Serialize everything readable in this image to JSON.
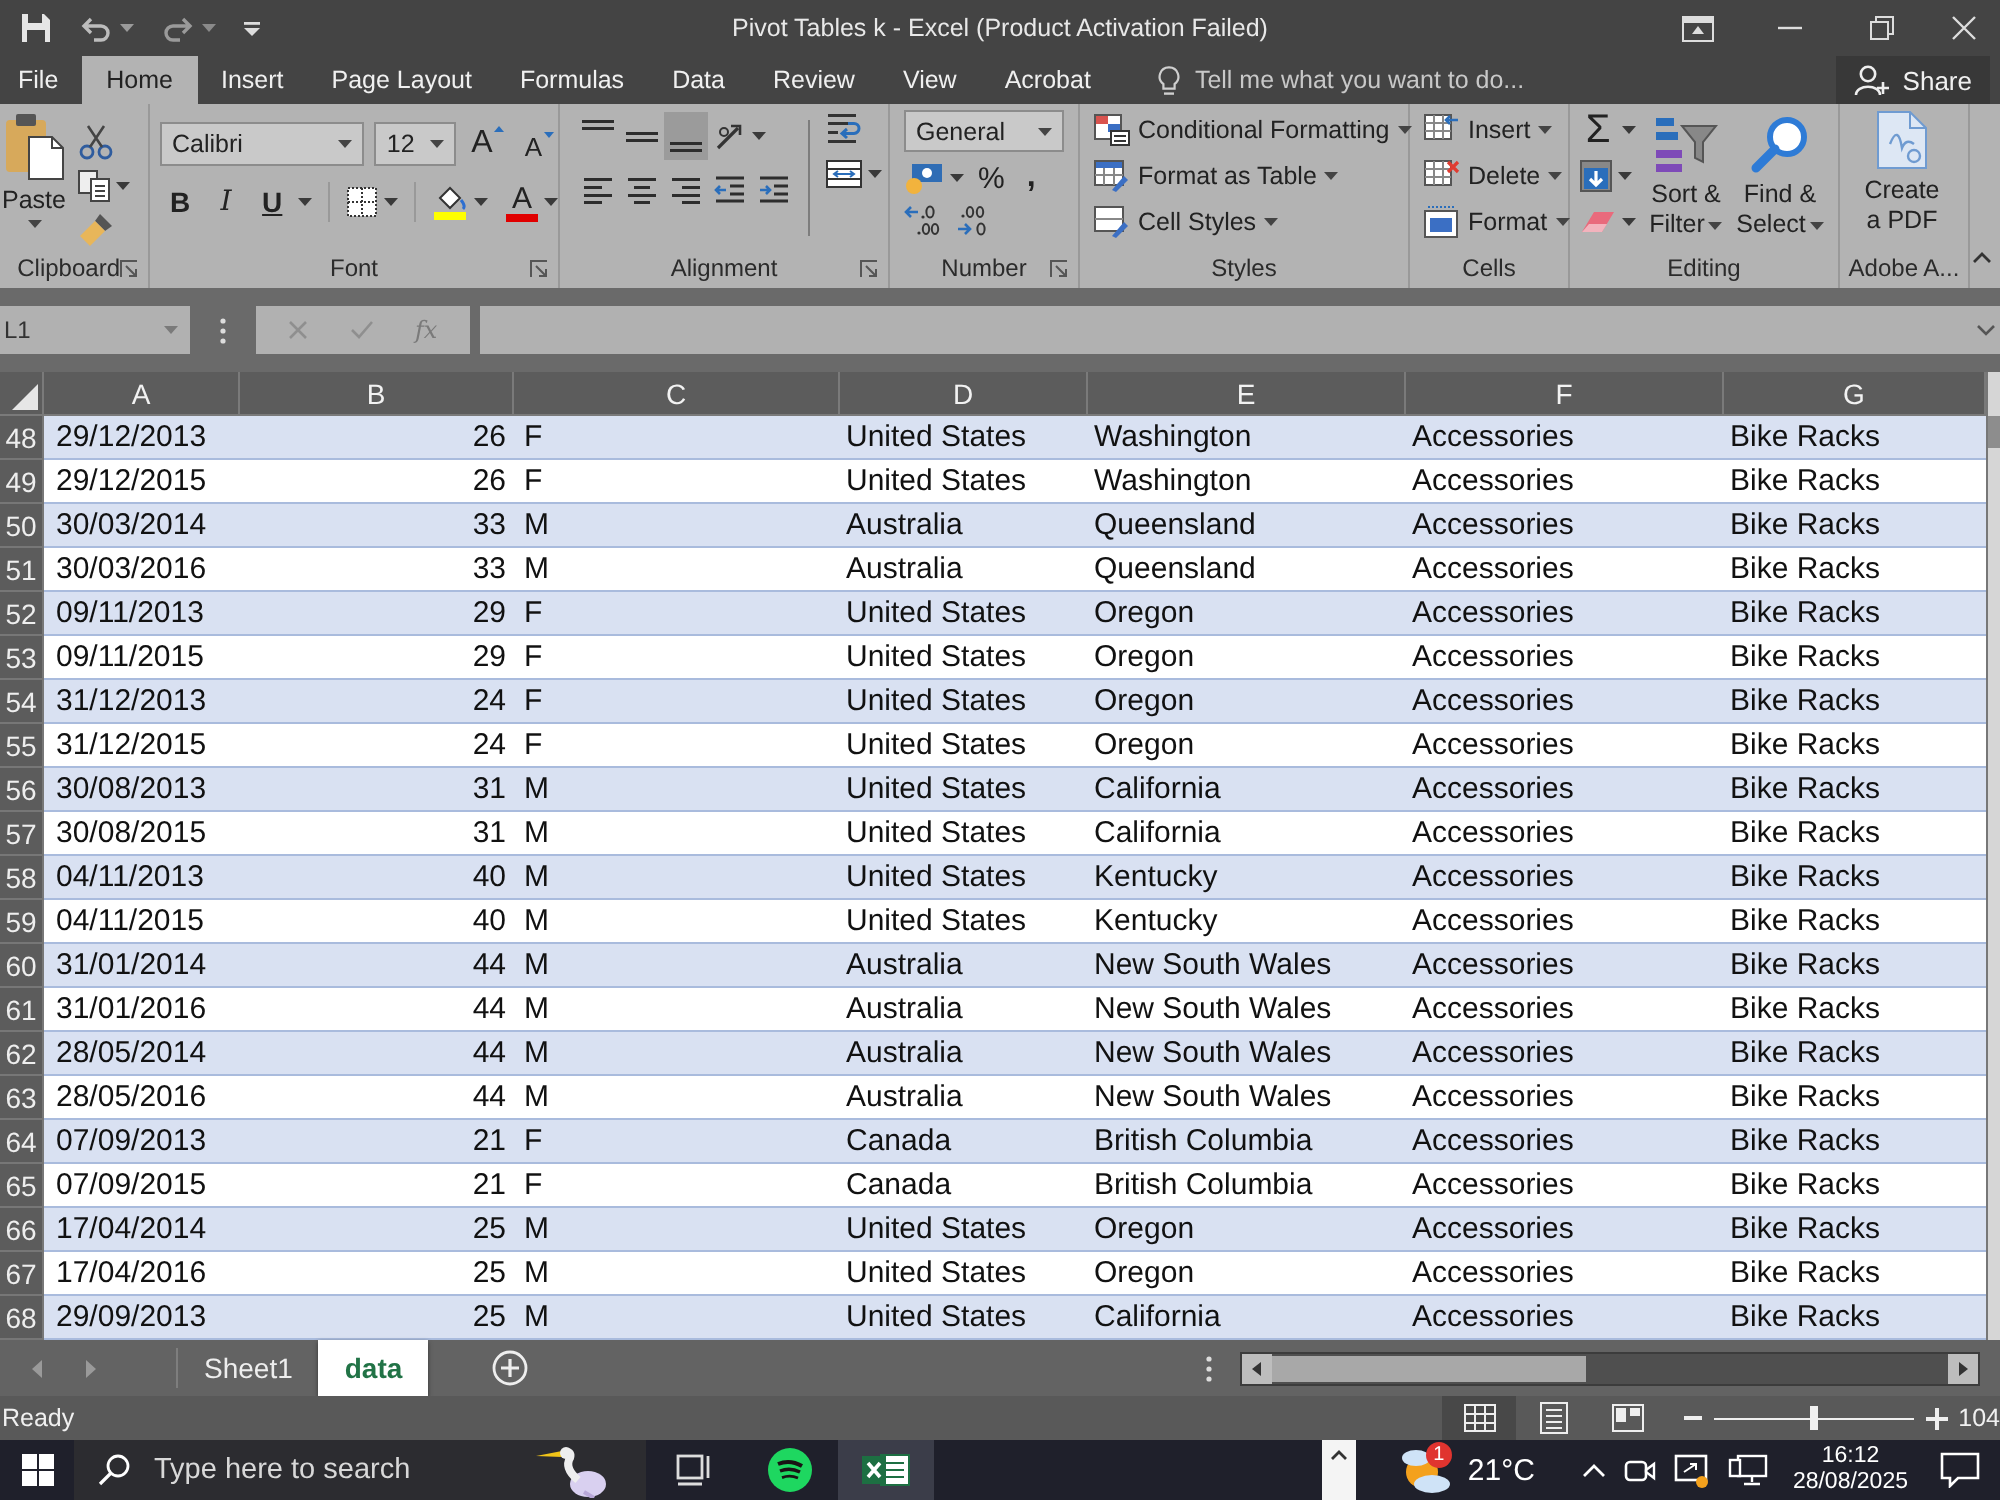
{
  "title_bar": {
    "title": "Pivot Tables k - Excel (Product Activation Failed)"
  },
  "ribbon_tabs": [
    {
      "label": "File",
      "selected": false
    },
    {
      "label": "Home",
      "selected": true
    },
    {
      "label": "Insert",
      "selected": false
    },
    {
      "label": "Page Layout",
      "selected": false
    },
    {
      "label": "Formulas",
      "selected": false
    },
    {
      "label": "Data",
      "selected": false
    },
    {
      "label": "Review",
      "selected": false
    },
    {
      "label": "View",
      "selected": false
    },
    {
      "label": "Acrobat",
      "selected": false
    }
  ],
  "tell_me": {
    "placeholder": "Tell me what you want to do..."
  },
  "share": "Share",
  "ribbon": {
    "clipboard": {
      "paste": "Paste",
      "label": "Clipboard"
    },
    "font": {
      "name": "Calibri",
      "size": "12",
      "grow": "A",
      "shrink": "A",
      "bold": "B",
      "italic": "I",
      "underline": "U",
      "color_letter": "A",
      "label": "Font"
    },
    "alignment": {
      "vertical": [
        {
          "kind": "top",
          "selected": false
        },
        {
          "kind": "middle",
          "selected": false
        },
        {
          "kind": "bottom",
          "selected": true
        }
      ],
      "label": "Alignment"
    },
    "number": {
      "format": "General",
      "percent": "%",
      "comma": ",",
      "label": "Number"
    },
    "styles": {
      "buttons": [
        {
          "kind": "conditional",
          "label": "Conditional Formatting"
        },
        {
          "kind": "table",
          "label": "Format as Table"
        },
        {
          "kind": "cell_styles",
          "label": "Cell Styles"
        }
      ],
      "label": "Styles"
    },
    "cells": {
      "buttons": [
        {
          "kind": "insert",
          "label": "Insert"
        },
        {
          "kind": "delete",
          "label": "Delete"
        },
        {
          "kind": "format",
          "label": "Format"
        }
      ],
      "label": "Cells"
    },
    "editing": {
      "sum": "Σ",
      "sort": "Sort & Filter",
      "find": "Find & Select",
      "label": "Editing"
    },
    "adobe": {
      "create": "Create a PDF",
      "label": "Adobe A..."
    }
  },
  "formula_bar": {
    "name_box": "L1",
    "edit_buttons": [
      {
        "kind": "cancel",
        "disabled": true
      },
      {
        "kind": "enter",
        "disabled": true
      }
    ],
    "fx": "fx"
  },
  "sheet": {
    "columns": [
      "A",
      "B",
      "C",
      "D",
      "E",
      "F",
      "G"
    ],
    "rows": [
      {
        "number": "48",
        "cells": [
          "29/12/2013",
          "26",
          "F",
          "United States",
          "Washington",
          "Accessories",
          "Bike Racks"
        ]
      },
      {
        "number": "49",
        "cells": [
          "29/12/2015",
          "26",
          "F",
          "United States",
          "Washington",
          "Accessories",
          "Bike Racks"
        ]
      },
      {
        "number": "50",
        "cells": [
          "30/03/2014",
          "33",
          "M",
          "Australia",
          "Queensland",
          "Accessories",
          "Bike Racks"
        ]
      },
      {
        "number": "51",
        "cells": [
          "30/03/2016",
          "33",
          "M",
          "Australia",
          "Queensland",
          "Accessories",
          "Bike Racks"
        ]
      },
      {
        "number": "52",
        "cells": [
          "09/11/2013",
          "29",
          "F",
          "United States",
          "Oregon",
          "Accessories",
          "Bike Racks"
        ]
      },
      {
        "number": "53",
        "cells": [
          "09/11/2015",
          "29",
          "F",
          "United States",
          "Oregon",
          "Accessories",
          "Bike Racks"
        ]
      },
      {
        "number": "54",
        "cells": [
          "31/12/2013",
          "24",
          "F",
          "United States",
          "Oregon",
          "Accessories",
          "Bike Racks"
        ]
      },
      {
        "number": "55",
        "cells": [
          "31/12/2015",
          "24",
          "F",
          "United States",
          "Oregon",
          "Accessories",
          "Bike Racks"
        ]
      },
      {
        "number": "56",
        "cells": [
          "30/08/2013",
          "31",
          "M",
          "United States",
          "California",
          "Accessories",
          "Bike Racks"
        ]
      },
      {
        "number": "57",
        "cells": [
          "30/08/2015",
          "31",
          "M",
          "United States",
          "California",
          "Accessories",
          "Bike Racks"
        ]
      },
      {
        "number": "58",
        "cells": [
          "04/11/2013",
          "40",
          "M",
          "United States",
          "Kentucky",
          "Accessories",
          "Bike Racks"
        ]
      },
      {
        "number": "59",
        "cells": [
          "04/11/2015",
          "40",
          "M",
          "United States",
          "Kentucky",
          "Accessories",
          "Bike Racks"
        ]
      },
      {
        "number": "60",
        "cells": [
          "31/01/2014",
          "44",
          "M",
          "Australia",
          "New South Wales",
          "Accessories",
          "Bike Racks"
        ]
      },
      {
        "number": "61",
        "cells": [
          "31/01/2016",
          "44",
          "M",
          "Australia",
          "New South Wales",
          "Accessories",
          "Bike Racks"
        ]
      },
      {
        "number": "62",
        "cells": [
          "28/05/2014",
          "44",
          "M",
          "Australia",
          "New South Wales",
          "Accessories",
          "Bike Racks"
        ]
      },
      {
        "number": "63",
        "cells": [
          "28/05/2016",
          "44",
          "M",
          "Australia",
          "New South Wales",
          "Accessories",
          "Bike Racks"
        ]
      },
      {
        "number": "64",
        "cells": [
          "07/09/2013",
          "21",
          "F",
          "Canada",
          "British Columbia",
          "Accessories",
          "Bike Racks"
        ]
      },
      {
        "number": "65",
        "cells": [
          "07/09/2015",
          "21",
          "F",
          "Canada",
          "British Columbia",
          "Accessories",
          "Bike Racks"
        ]
      },
      {
        "number": "66",
        "cells": [
          "17/04/2014",
          "25",
          "M",
          "United States",
          "Oregon",
          "Accessories",
          "Bike Racks"
        ]
      },
      {
        "number": "67",
        "cells": [
          "17/04/2016",
          "25",
          "M",
          "United States",
          "Oregon",
          "Accessories",
          "Bike Racks"
        ]
      },
      {
        "number": "68",
        "cells": [
          "29/09/2013",
          "25",
          "M",
          "United States",
          "California",
          "Accessories",
          "Bike Racks"
        ]
      }
    ]
  },
  "sheet_tabs": [
    {
      "label": "Sheet1",
      "selected": false
    },
    {
      "label": "data",
      "selected": true
    }
  ],
  "status_bar": {
    "status": "Ready",
    "views": [
      {
        "kind": "normal",
        "selected": true
      },
      {
        "kind": "page_layout",
        "selected": false
      },
      {
        "kind": "page_break",
        "selected": false
      }
    ],
    "zoom": {
      "level": 0.5,
      "reading": "104"
    }
  },
  "taskbar": {
    "search": {
      "placeholder": "Type here to search"
    },
    "apps": [
      {
        "kind": "task_view",
        "selected": false
      },
      {
        "kind": "spotify",
        "selected": false
      },
      {
        "kind": "excel",
        "selected": true
      }
    ],
    "weather": {
      "badge": "1",
      "temperature": "21°C"
    },
    "time": "16:12",
    "date": "28/08/2025"
  }
}
